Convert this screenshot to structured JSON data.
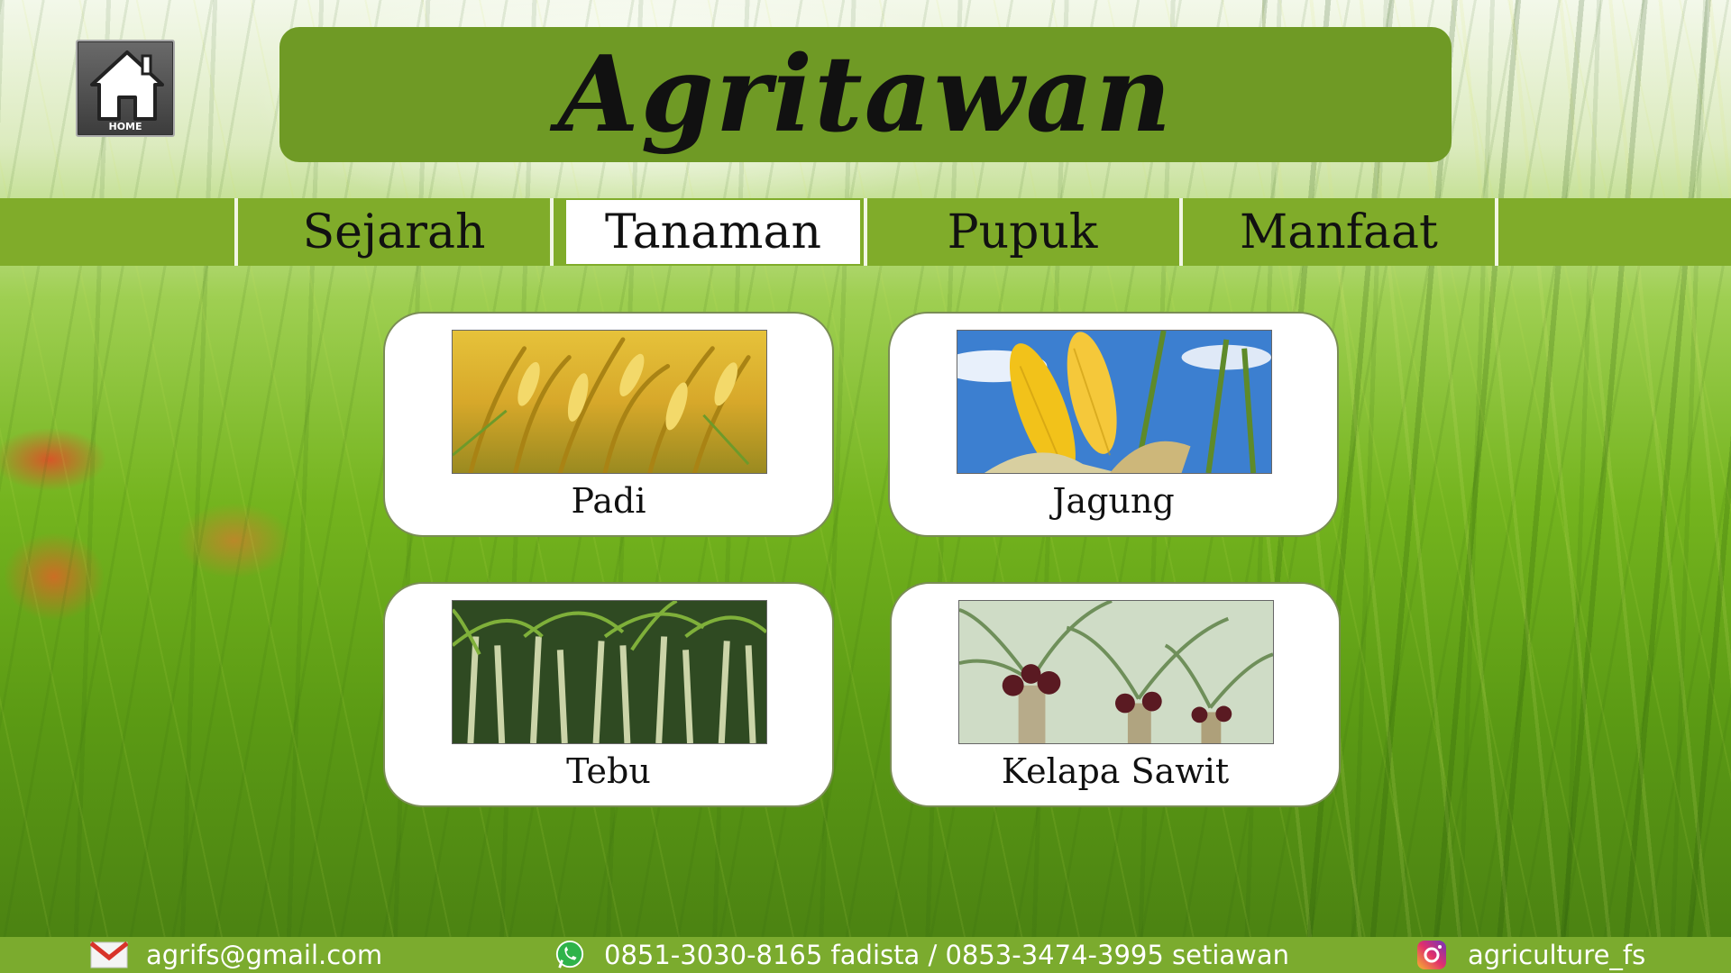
{
  "header": {
    "home_label": "HOME",
    "title": "Agritawan"
  },
  "nav": {
    "items": [
      {
        "label": "Sejarah",
        "active": false
      },
      {
        "label": "Tanaman",
        "active": true
      },
      {
        "label": "Pupuk",
        "active": false
      },
      {
        "label": "Manfaat",
        "active": false
      }
    ]
  },
  "crops": [
    {
      "label": "Padi",
      "image": "rice-plant-photo"
    },
    {
      "label": "Jagung",
      "image": "corn-cob-photo"
    },
    {
      "label": "Tebu",
      "image": "sugarcane-photo"
    },
    {
      "label": "Kelapa Sawit",
      "image": "oil-palm-photo"
    }
  ],
  "footer": {
    "email": "agrifs@gmail.com",
    "email_icon": "mail-icon",
    "phone": "0851-3030-8165 fadista / 0853-3474-3995 setiawan",
    "phone_icon": "whatsapp-icon",
    "instagram": "agriculture_fs",
    "instagram_icon": "instagram-icon"
  },
  "colors": {
    "accent_green": "#80ac2a",
    "banner_green": "#6f9a25",
    "footer_green": "#7bab2e"
  }
}
